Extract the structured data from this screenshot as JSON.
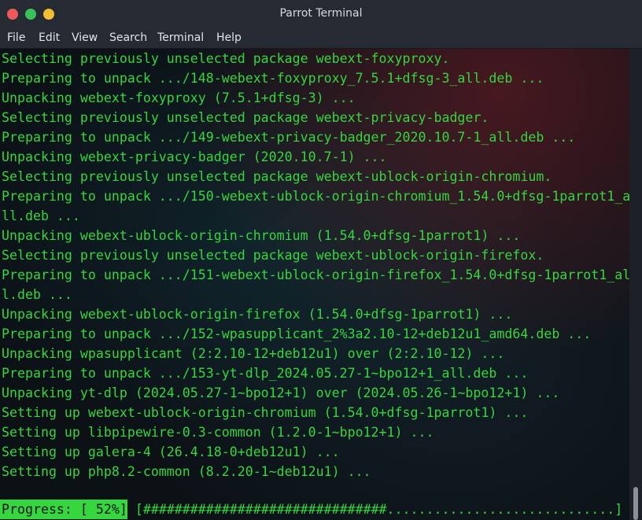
{
  "window": {
    "title": "Parrot Terminal"
  },
  "menu": {
    "items": [
      "File",
      "Edit",
      "View",
      "Search",
      "Terminal",
      "Help"
    ]
  },
  "terminal": {
    "lines": [
      "Selecting previously unselected package webext-foxyproxy.",
      "Preparing to unpack .../148-webext-foxyproxy_7.5.1+dfsg-3_all.deb ...",
      "Unpacking webext-foxyproxy (7.5.1+dfsg-3) ...",
      "Selecting previously unselected package webext-privacy-badger.",
      "Preparing to unpack .../149-webext-privacy-badger_2020.10.7-1_all.deb ...",
      "Unpacking webext-privacy-badger (2020.10.7-1) ...",
      "Selecting previously unselected package webext-ublock-origin-chromium.",
      "Preparing to unpack .../150-webext-ublock-origin-chromium_1.54.0+dfsg-1parrot1_a",
      "ll.deb ...",
      "Unpacking webext-ublock-origin-chromium (1.54.0+dfsg-1parrot1) ...",
      "Selecting previously unselected package webext-ublock-origin-firefox.",
      "Preparing to unpack .../151-webext-ublock-origin-firefox_1.54.0+dfsg-1parrot1_al",
      "l.deb ...",
      "Unpacking webext-ublock-origin-firefox (1.54.0+dfsg-1parrot1) ...",
      "Preparing to unpack .../152-wpasupplicant_2%3a2.10-12+deb12u1_amd64.deb ...",
      "Unpacking wpasupplicant (2:2.10-12+deb12u1) over (2:2.10-12) ...",
      "Preparing to unpack .../153-yt-dlp_2024.05.27-1~bpo12+1_all.deb ...",
      "Unpacking yt-dlp (2024.05.27-1~bpo12+1) over (2024.05.26-1~bpo12+1) ...",
      "Setting up webext-ublock-origin-chromium (1.54.0+dfsg-1parrot1) ...",
      "Setting up libpipewire-0.3-common (1.2.0-1~bpo12+1) ...",
      "Setting up galera-4 (26.4.18-0+deb12u1) ...",
      "Setting up php8.2-common (8.2.20-1~deb12u1) ..."
    ],
    "progress_label": "Progress: [ 52%]",
    "progress_bar": "[###############################.............................]",
    "progress_percent": 52
  },
  "colors": {
    "terminal_text": "#35d63e",
    "titlebar": "#262b33",
    "close": "#ee5a5a",
    "maximize": "#3bc15a",
    "minimize": "#f2be33"
  }
}
